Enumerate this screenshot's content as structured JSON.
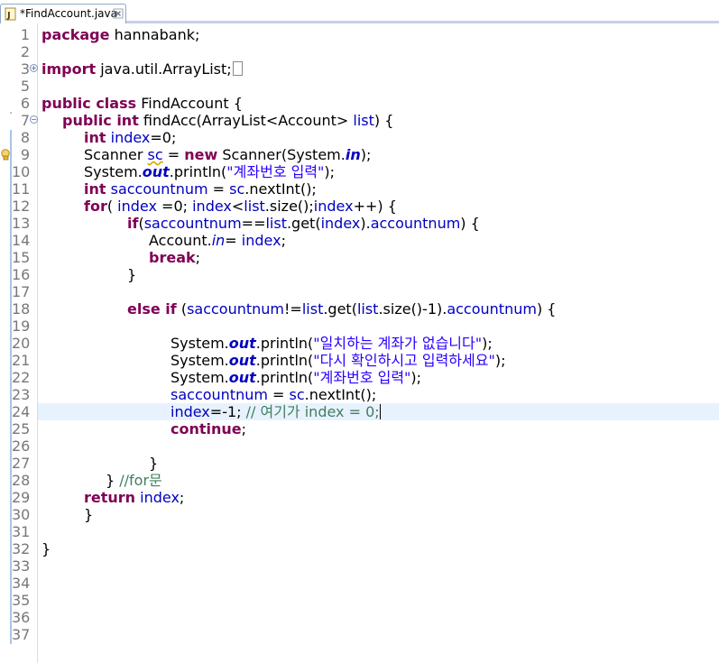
{
  "tab": {
    "title": "*FindAccount.java",
    "icon": "java-file-icon"
  },
  "colors": {
    "keyword": "#7f0055",
    "field": "#0000c0",
    "string": "#2a00ff",
    "comment": "#3f7f5f",
    "current_line": "#e8f2fe"
  },
  "code": {
    "line_numbers": [
      "1",
      "2",
      "3",
      "5",
      "6",
      "7",
      "8",
      "9",
      "10",
      "11",
      "12",
      "13",
      "14",
      "15",
      "16",
      "17",
      "18",
      "19",
      "20",
      "21",
      "22",
      "23",
      "24",
      "25",
      "26",
      "27",
      "28",
      "29",
      "30",
      "31",
      "32",
      "33",
      "34",
      "35",
      "36",
      "37"
    ],
    "l1": {
      "kw": "package",
      "rest": " hannabank;"
    },
    "l3": {
      "kw": "import",
      "rest": " java.util.ArrayList;"
    },
    "l6": {
      "kw": "public class",
      "rest": " FindAccount {"
    },
    "l7": {
      "kw": "public int",
      "rest": " findAcc(ArrayList<Account> ",
      "p": "list",
      "end": ") {"
    },
    "l8": {
      "kw": "int",
      "v": " index",
      "rest": "=0;"
    },
    "l9": {
      "a": "Scanner ",
      "v": "sc",
      "b": " = ",
      "kw": "new",
      "c": " Scanner(System.",
      "f": "in",
      "d": ");"
    },
    "l10": {
      "a": "System.",
      "f": "out",
      "b": ".println(",
      "s": "\"계좌번호 입력\"",
      "c": ");"
    },
    "l11": {
      "kw": "int",
      "v": " saccountnum",
      "a": " = ",
      "v2": "sc",
      "b": ".nextInt();"
    },
    "l12": {
      "kw": "for",
      "a": "( ",
      "v": "index",
      "b": " =0; ",
      "v2": "index",
      "c": "<",
      "v3": "list",
      "d": ".size();",
      "v4": "index",
      "e": "++) {"
    },
    "l13": {
      "kw": "if",
      "a": "(",
      "v": "saccountnum",
      "b": "==",
      "v2": "list",
      "c": ".get(",
      "v3": "index",
      "d": ").",
      "f": "accountnum",
      "e": ") {"
    },
    "l14": {
      "a": "Account.",
      "f": "in",
      "b": "= ",
      "v": "index",
      "c": ";"
    },
    "l15": {
      "kw": "break",
      "a": ";"
    },
    "l16": {
      "a": "}"
    },
    "l18": {
      "kw": "else if",
      "a": " (",
      "v": "saccountnum",
      "b": "!=",
      "v2": "list",
      "c": ".get(",
      "v3": "list",
      "d": ".size()-1).",
      "f": "accountnum",
      "e": ") {"
    },
    "l20": {
      "a": "System.",
      "f": "out",
      "b": ".println(",
      "s": "\"일치하는 계좌가 없습니다\"",
      "c": ");"
    },
    "l21": {
      "a": "System.",
      "f": "out",
      "b": ".println(",
      "s": "\"다시 확인하시고 입력하세요\"",
      "c": ");"
    },
    "l22": {
      "a": "System.",
      "f": "out",
      "b": ".println(",
      "s": "\"계좌번호 입력\"",
      "c": ");"
    },
    "l23": {
      "v": "saccountnum",
      "a": " = ",
      "v2": "sc",
      "b": ".nextInt();"
    },
    "l24": {
      "v": "index",
      "a": "=-1; ",
      "cmt": "// 여기가 index = 0;"
    },
    "l25": {
      "kw": "continue",
      "a": ";"
    },
    "l27": {
      "a": "}"
    },
    "l28": {
      "a": "} ",
      "cmt": "//for문"
    },
    "l29": {
      "kw": "return",
      "v": " index",
      "a": ";"
    },
    "l30": {
      "a": "}"
    },
    "l32": {
      "a": "}"
    }
  }
}
